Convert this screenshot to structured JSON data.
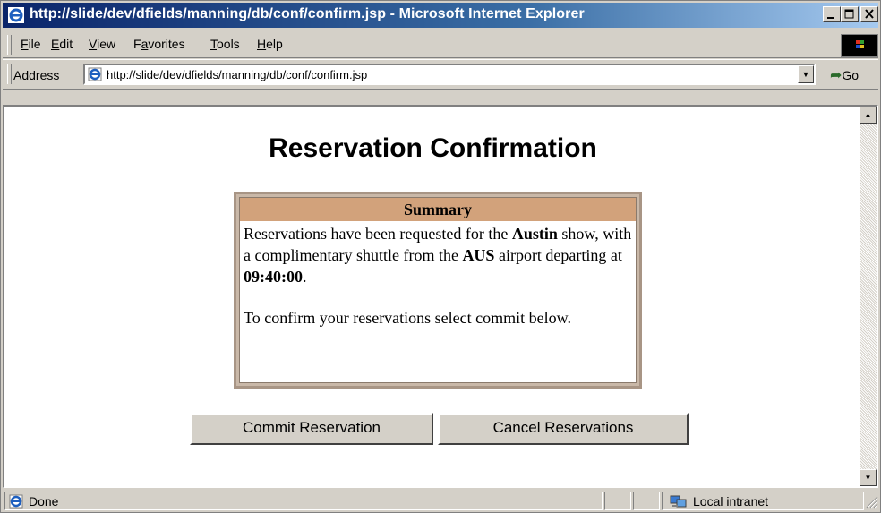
{
  "window": {
    "title": "http://slide/dev/dfields/manning/db/conf/confirm.jsp - Microsoft Internet Explorer"
  },
  "menu": {
    "items": [
      {
        "label": "File",
        "key": "F",
        "rest": "ile"
      },
      {
        "label": "Edit",
        "key": "E",
        "rest": "dit"
      },
      {
        "label": "View",
        "key": "V",
        "rest": "iew"
      },
      {
        "label": "Favorites",
        "key": "a",
        "pre": "F",
        "rest": "vorites"
      },
      {
        "label": "Tools",
        "key": "T",
        "rest": "ools"
      },
      {
        "label": "Help",
        "key": "H",
        "rest": "elp"
      }
    ]
  },
  "address": {
    "label": "Address",
    "url": "http://slide/dev/dfields/manning/db/conf/confirm.jsp",
    "go_label": "Go"
  },
  "page": {
    "title": "Reservation Confirmation",
    "summary": {
      "heading": "Summary",
      "line1_pre": "Reservations have been requested for the ",
      "city": "Austin",
      "line1_post": " show, with a complimentary shuttle from the ",
      "airport": "AUS",
      "line1_mid": " airport departing at ",
      "time": "09:40:00",
      "line1_end": ".",
      "instruction": "To confirm your reservations select commit below."
    },
    "buttons": {
      "commit": "Commit Reservation",
      "cancel": "Cancel Reservations"
    }
  },
  "status": {
    "text": "Done",
    "zone": "Local intranet"
  },
  "colors": {
    "titlebar_start": "#0a246a",
    "summary_header": "#d2a27b",
    "chrome": "#d4d0c8"
  }
}
